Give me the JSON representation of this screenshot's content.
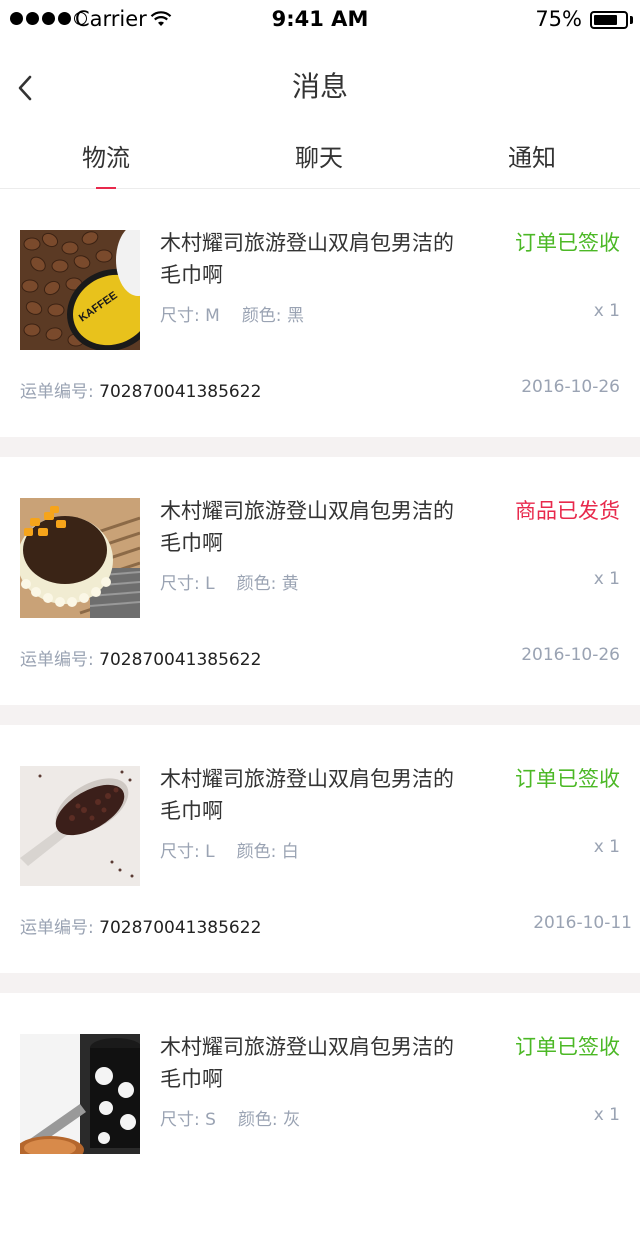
{
  "status_bar": {
    "carrier": "Carrier",
    "time": "9:41 AM",
    "battery": "75%",
    "battery_level": 0.75
  },
  "nav": {
    "back_icon": "chevron-left-icon",
    "title": "消息"
  },
  "tabs": [
    {
      "label": "物流",
      "active": true
    },
    {
      "label": "聊天",
      "active": false
    },
    {
      "label": "通知",
      "active": false
    }
  ],
  "colors": {
    "accent": "#e8294c",
    "status_signed": "#4cb826",
    "status_shipped": "#e8294c",
    "muted": "#9aa3b3",
    "divider": "#f5f2f2"
  },
  "orders": [
    {
      "title": "木村耀司旅游登山双肩包男洁的毛巾啊",
      "status": "订单已签收",
      "status_color": "#4cb826",
      "size_label": "尺寸: M",
      "color_label": "颜色: 黑",
      "qty": "x 1",
      "waybill_label": "运单编号:",
      "waybill_number": "702870041385622",
      "date": "2016-10-26",
      "thumb": "coffee-beans-image"
    },
    {
      "title": "木村耀司旅游登山双肩包男洁的毛巾啊",
      "status": "商品已发货",
      "status_color": "#e8294c",
      "size_label": "尺寸: L",
      "color_label": "颜色: 黄",
      "qty": "x 1",
      "waybill_label": "运单编号:",
      "waybill_number": "702870041385622",
      "date": "2016-10-26",
      "thumb": "chocolate-cake-image"
    },
    {
      "title": "木村耀司旅游登山双肩包男洁的毛巾啊",
      "status": "订单已签收",
      "status_color": "#4cb826",
      "size_label": "尺寸: L",
      "color_label": "颜色: 白",
      "qty": "x 1",
      "waybill_label": "运单编号:",
      "waybill_number": "702870041385622",
      "date": "2016-10-11",
      "thumb": "ground-coffee-spoon-image"
    },
    {
      "title": "木村耀司旅游登山双肩包男洁的毛巾啊",
      "status": "订单已签收",
      "status_color": "#4cb826",
      "size_label": "尺寸: S",
      "color_label": "颜色: 灰",
      "qty": "x 1",
      "thumb": "coffee-cup-image"
    }
  ]
}
